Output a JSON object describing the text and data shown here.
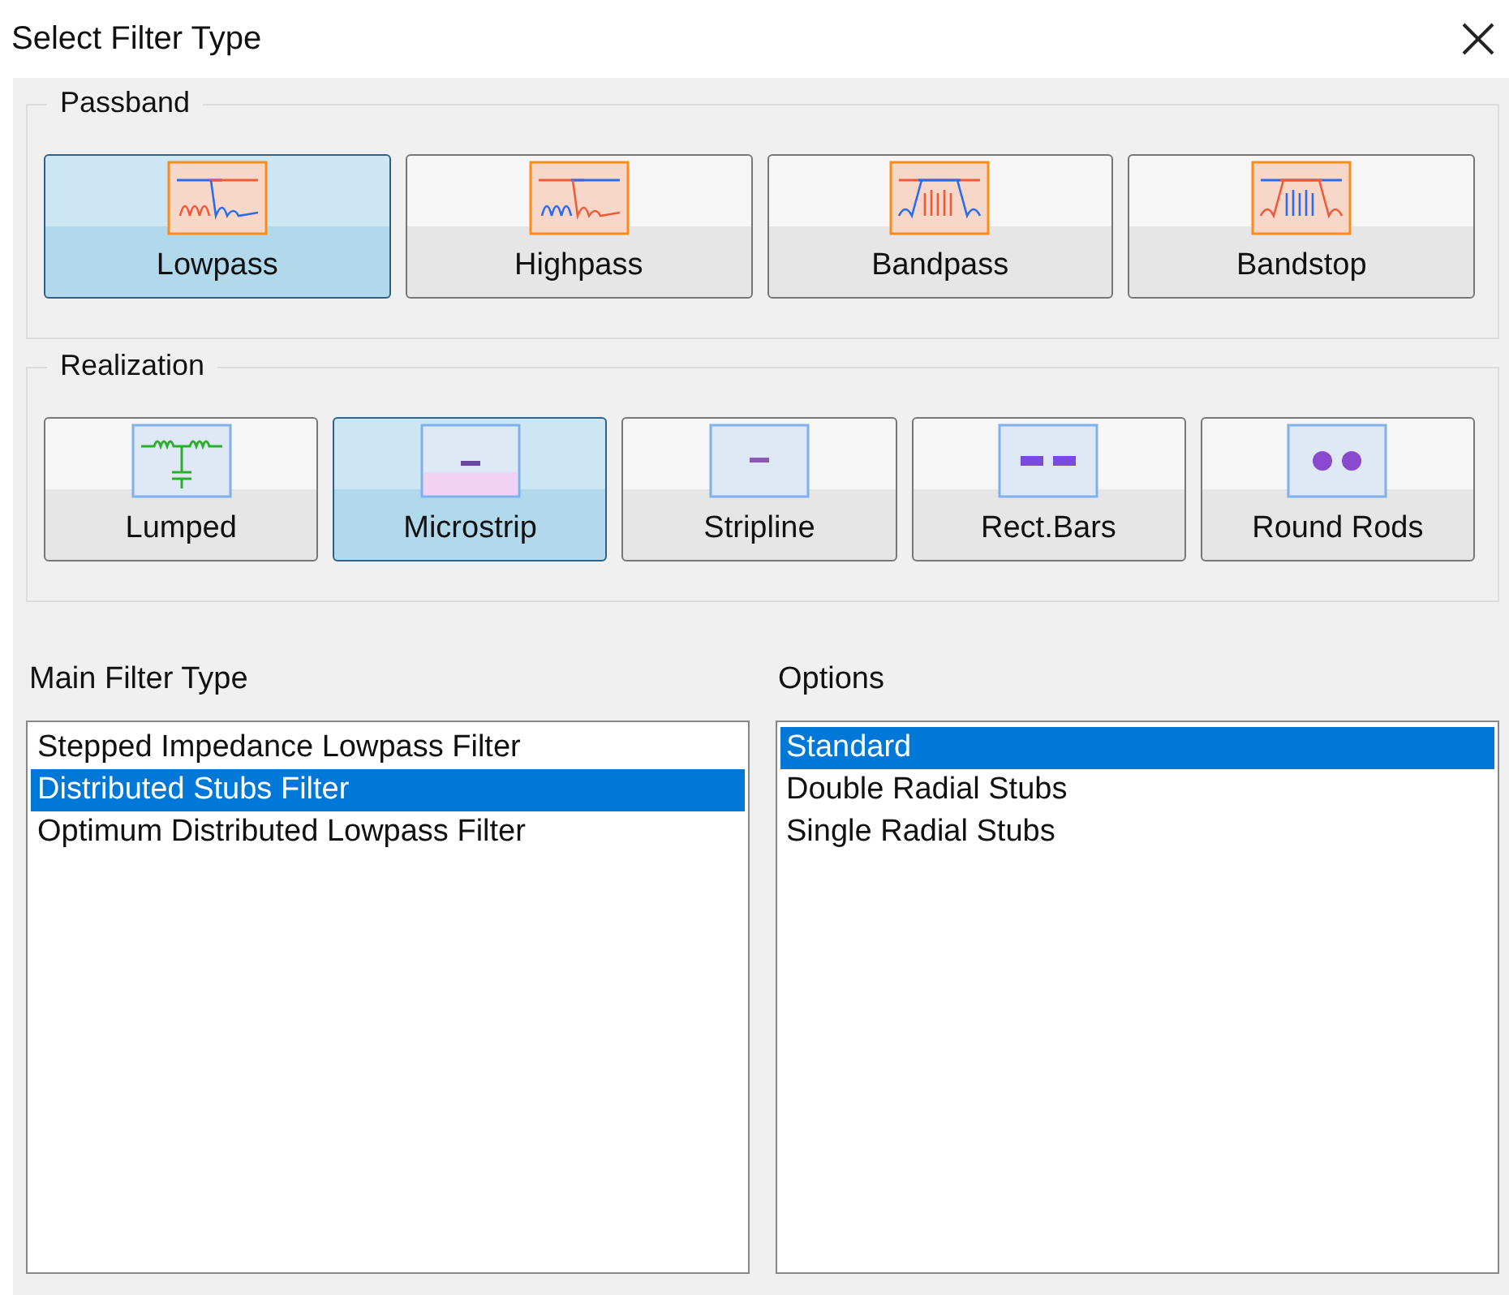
{
  "window": {
    "title": "Select Filter Type"
  },
  "passband": {
    "label": "Passband",
    "buttons": [
      {
        "label": "Lowpass",
        "kind": "lowpass",
        "selected": true
      },
      {
        "label": "Highpass",
        "kind": "highpass",
        "selected": false
      },
      {
        "label": "Bandpass",
        "kind": "bandpass",
        "selected": false
      },
      {
        "label": "Bandstop",
        "kind": "bandstop",
        "selected": false
      }
    ]
  },
  "realization": {
    "label": "Realization",
    "buttons": [
      {
        "label": "Lumped",
        "kind": "lumped",
        "selected": false
      },
      {
        "label": "Microstrip",
        "kind": "microstrip",
        "selected": true
      },
      {
        "label": "Stripline",
        "kind": "stripline",
        "selected": false
      },
      {
        "label": "Rect.Bars",
        "kind": "rectbars",
        "selected": false
      },
      {
        "label": "Round Rods",
        "kind": "roundrods",
        "selected": false
      }
    ]
  },
  "main_filter_type": {
    "label": "Main Filter Type",
    "items": [
      {
        "text": "Stepped Impedance Lowpass Filter",
        "selected": false
      },
      {
        "text": "Distributed Stubs Filter",
        "selected": true
      },
      {
        "text": "Optimum Distributed Lowpass Filter",
        "selected": false
      }
    ]
  },
  "options": {
    "label": "Options",
    "items": [
      {
        "text": "Standard",
        "selected": true
      },
      {
        "text": "Double Radial Stubs",
        "selected": false
      },
      {
        "text": "Single Radial Stubs",
        "selected": false
      }
    ]
  }
}
